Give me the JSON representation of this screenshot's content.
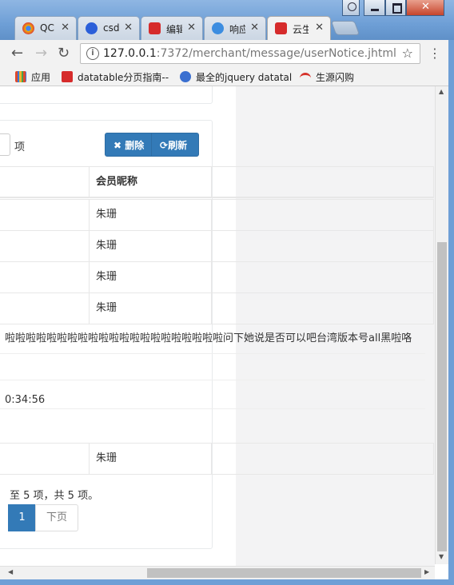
{
  "browser": {
    "tabs": [
      {
        "label": "QC",
        "fav_color": "#f4b400"
      },
      {
        "label": "csd",
        "fav_color": "#2b5fd9"
      },
      {
        "label": "编辑",
        "fav_color": "#d62b2b"
      },
      {
        "label": "响应",
        "fav_color": "#3c8de0"
      },
      {
        "label": "云生",
        "fav_color": "#d62b2b"
      }
    ],
    "url_host": "127.0.0.1",
    "url_rest": ":7372/merchant/message/userNotice.jhtml",
    "bookmarks": [
      {
        "label": "应用"
      },
      {
        "label": "datatable分页指南--"
      },
      {
        "label": "最全的jquery datatal"
      },
      {
        "label": "生源闪购"
      }
    ]
  },
  "toolbar": {
    "length_suffix": "项",
    "delete_label": "删除",
    "refresh_label": "刷新"
  },
  "table": {
    "column_header": "会员昵称",
    "rows": [
      "朱珊",
      "朱珊",
      "朱珊",
      "朱珊"
    ],
    "detail_content": "啦啦啦啦啦啦啦啦啦啦啦啦啦啦啦啦啦啦啦啦啦问下她说是否可以吧台湾版本号all黑啦咯",
    "detail_time": "0:34:56",
    "last_row": "朱珊"
  },
  "pagination": {
    "info": "至 5 项，共 5 项。",
    "current_page": "1",
    "next_label": "下页"
  }
}
